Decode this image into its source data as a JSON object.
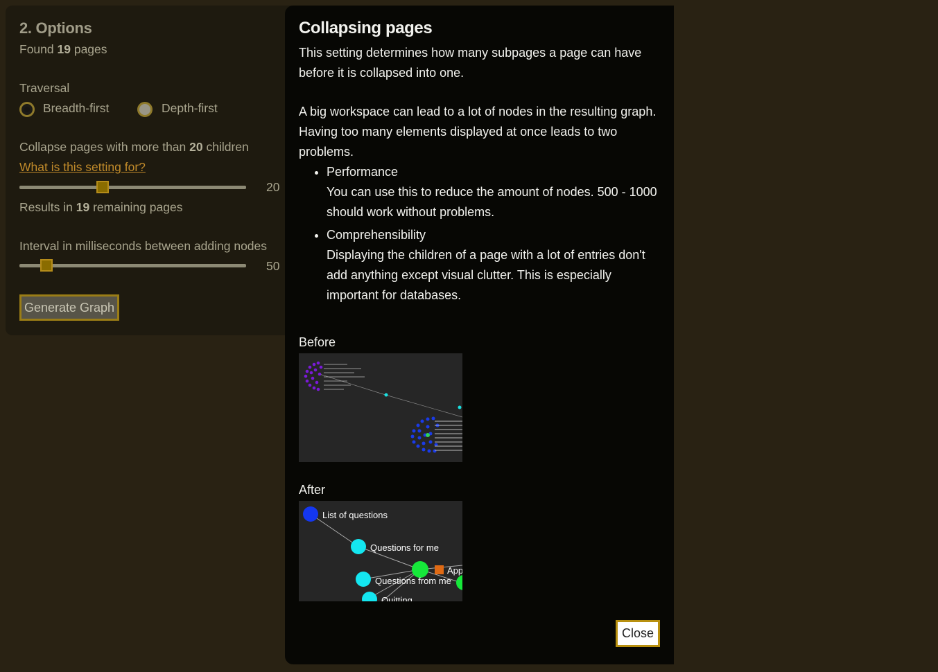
{
  "options": {
    "title": "2. Options",
    "found_prefix": "Found",
    "found_count": "19",
    "found_suffix": "pages",
    "traversal_label": "Traversal",
    "radio_breadth": "Breadth-first",
    "radio_depth": "Depth-first",
    "collapse_prefix": "Collapse pages with more than",
    "collapse_value": "20",
    "collapse_suffix": "children",
    "help_link": "What is this setting for?",
    "collapse_slider_display": "20",
    "results_prefix": "Results in",
    "results_count": "19",
    "results_suffix": "remaining pages",
    "interval_label": "Interval in milliseconds between adding nodes",
    "interval_slider_display": "50",
    "generate_button": "Generate Graph"
  },
  "modal": {
    "title": "Collapsing pages",
    "intro": "This setting determines how many subpages a page can have before it is collapsed into one.",
    "para2": "A big workspace can lead to a lot of nodes in the resulting graph. Having too many elements displayed at once leads to two problems.",
    "items": [
      {
        "heading": "Performance",
        "text": "You can use this to reduce the amount of nodes. 500 - 1000 should work without problems."
      },
      {
        "heading": "Comprehensibility",
        "text": "Displaying the children of a page with a lot of entries don't add anything except visual clutter. This is especially important for databases."
      }
    ],
    "before_label": "Before",
    "after_label": "After",
    "after_nodes": [
      "List of questions",
      "Questions for me",
      "Questions from me",
      "Quitting",
      "App"
    ],
    "close_button": "Close"
  },
  "colors": {
    "accent": "#b8900f",
    "link": "#c08a2a",
    "background": "#292213",
    "modal": "#070704"
  }
}
